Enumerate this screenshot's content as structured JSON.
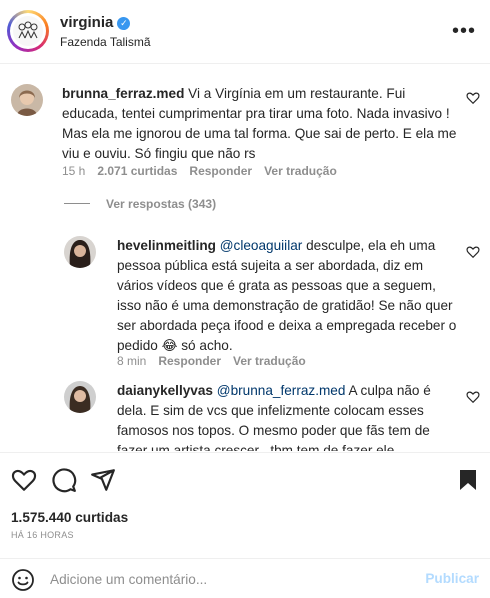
{
  "post": {
    "username": "virginia",
    "location": "Fazenda Talismã",
    "more_label": "•••"
  },
  "comments": [
    {
      "username": "brunna_ferraz.med",
      "text": "Vi a Virgínia em um restaurante. Fui educada, tentei cumprimentar pra tirar uma foto. Nada invasivo ! Mas ela me ignorou de uma tal forma. Que sai de perto. E ela me viu e ouviu. Só fingiu que não rs",
      "time": "15 h",
      "likes": "2.071 curtidas",
      "reply_label": "Responder",
      "translate_label": "Ver tradução"
    }
  ],
  "view_replies_label": "Ver respostas (343)",
  "replies": [
    {
      "username": "hevelinmeitling",
      "mention": "@cleoaguiilar",
      "text": " desculpe, ela eh uma pessoa pública está sujeita a ser abordada, diz em vários vídeos que é grata as pessoas que a seguem, isso não é uma demonstração de gratidão! Se não quer ser abordada peça ifood e deixa a empregada receber o pedido 😂 só acho.",
      "time": "8 min",
      "reply_label": "Responder",
      "translate_label": "Ver tradução"
    },
    {
      "username": "daianykellyvas",
      "mention": "@brunna_ferraz.med",
      "text": " A culpa não é dela. E sim de vcs que infelizmente colocam esses famosos nos topos. O mesmo poder que fãs tem de fazer um artista crescer , tbm tem de fazer ele"
    }
  ],
  "footer": {
    "likes": "1.575.440 curtidas",
    "time": "HÁ 16 HORAS",
    "comment_placeholder": "Adicione um comentário...",
    "post_label": "Publicar"
  },
  "icons": {
    "like": "heart-icon",
    "comment": "comment-icon",
    "share": "share-icon",
    "save": "bookmark-icon",
    "emoji": "emoji-icon",
    "verified": "verified-badge-icon"
  }
}
